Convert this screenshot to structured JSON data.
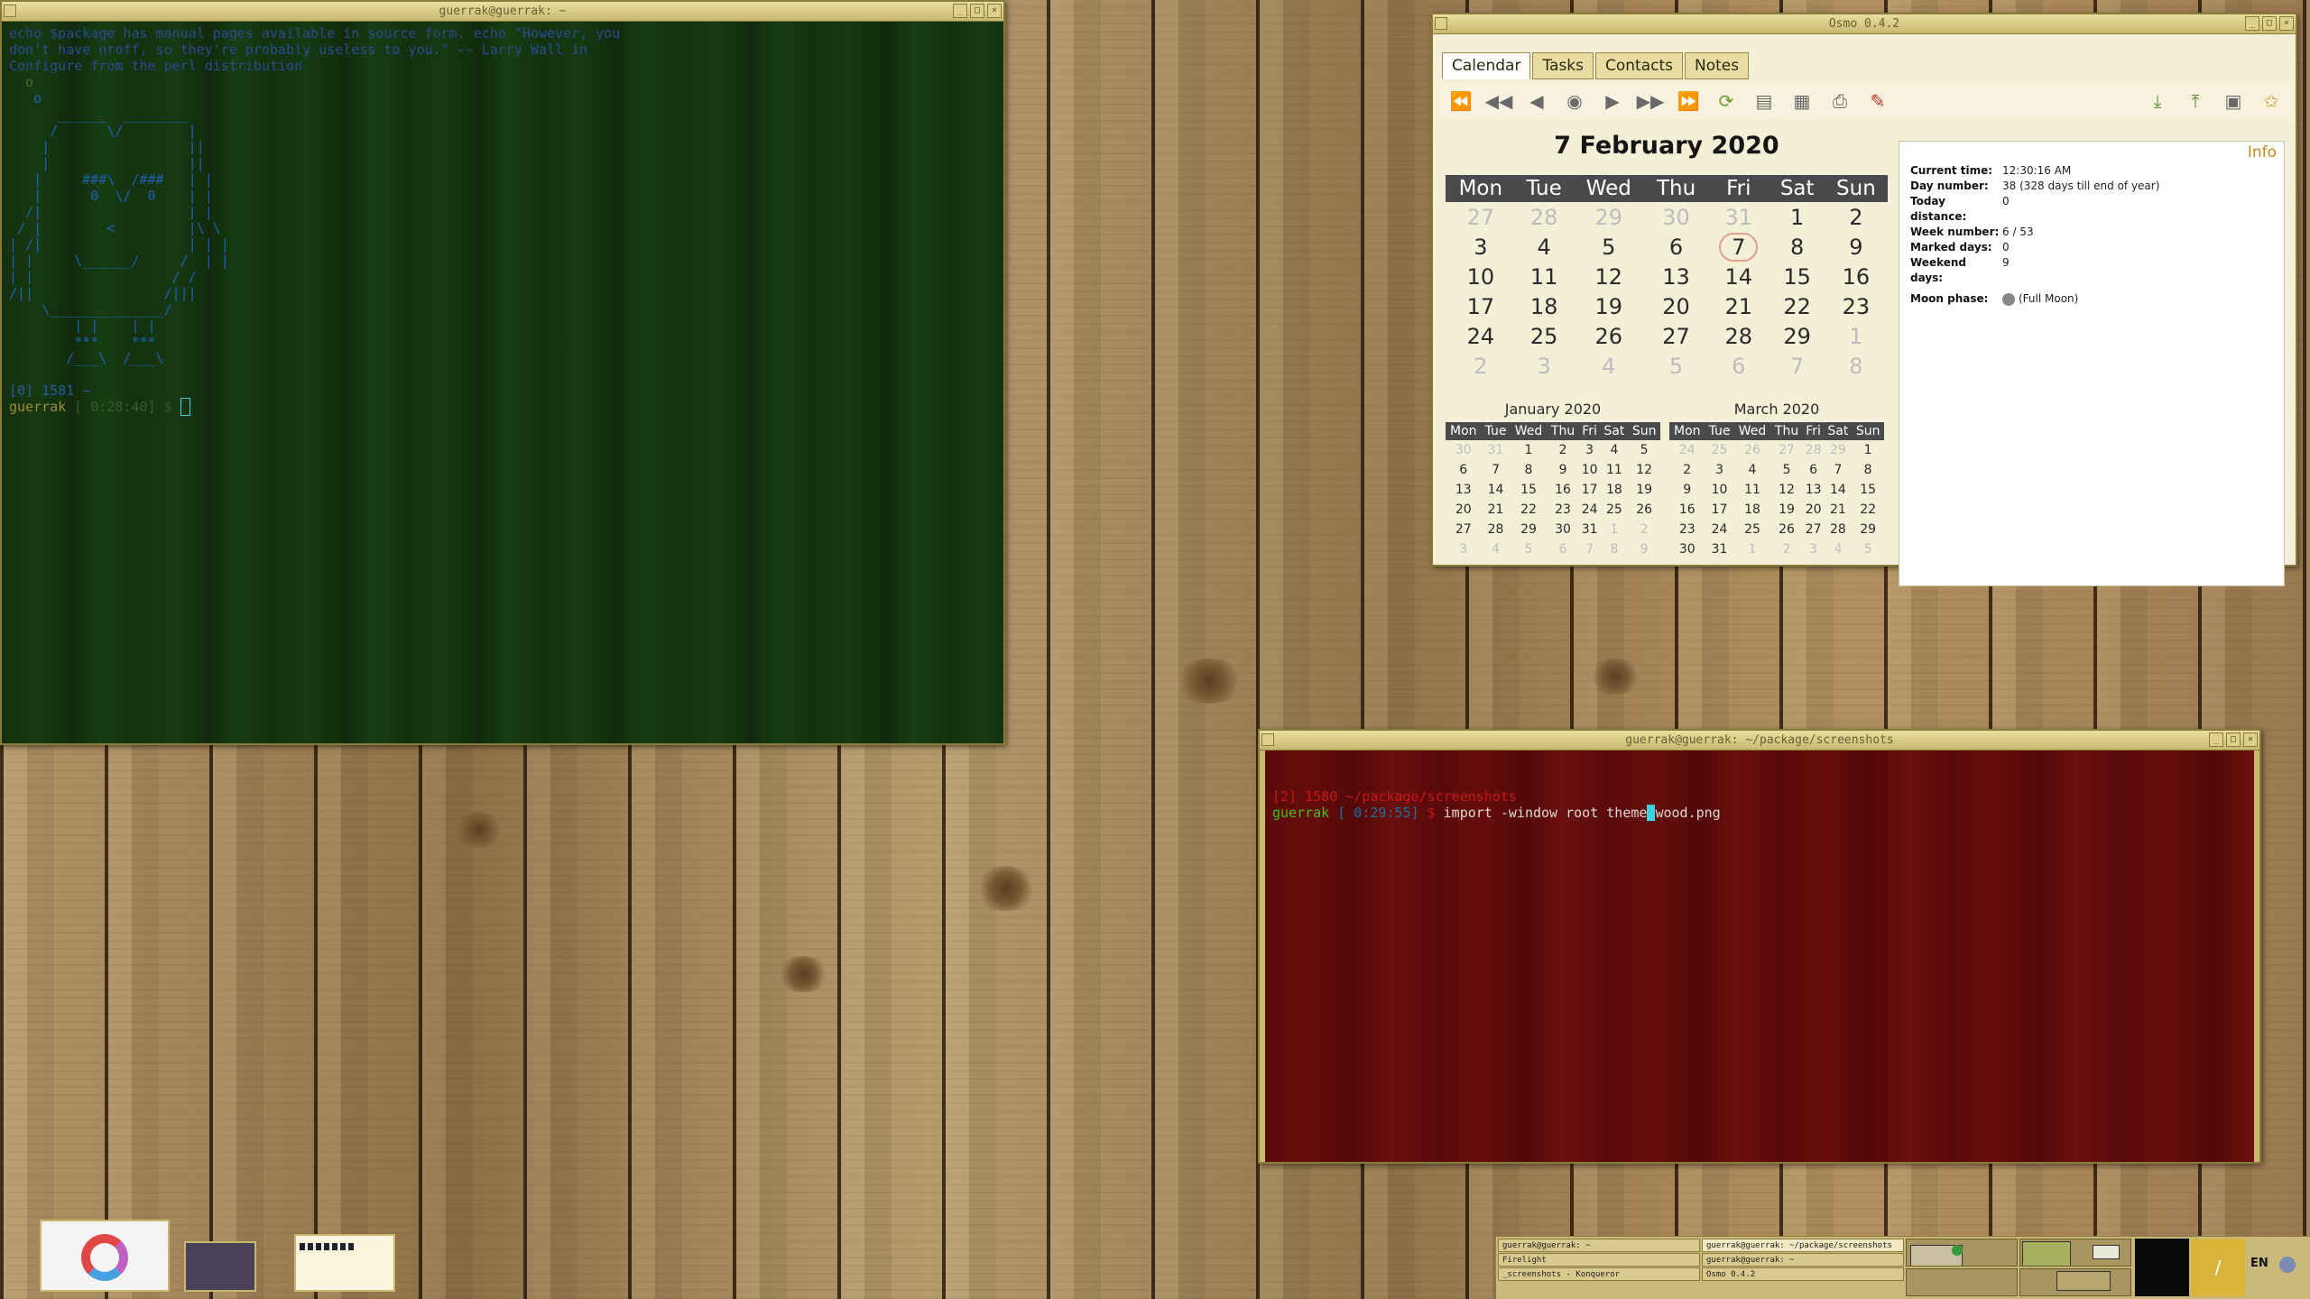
{
  "term1": {
    "title": "guerrak@guerrak: ~",
    "lines": [
      "echo $package has manual pages available in source form. echo \"However, you",
      "don't have nroff, so they're probably useless to you.\" -- Larry Wall in",
      "Configure from the perl distribution",
      "  o",
      "   o",
      "      ______  ________",
      "     /      \\/        |",
      "    |                 ||",
      "    |                 ||",
      "   |     ###\\  /###   | |",
      "   |      0  \\/  0    | |",
      "  /|                  | |",
      " / |        <         |\\ \\",
      "| /|                  | | |",
      "| |     \\______/     /  | |",
      "| |                 / /",
      "/||                /|||",
      "    \\______________/",
      "        | |    | |",
      "        ***    ***",
      "       /___\\  /___\\",
      "",
      "[0] 1581 ~",
      "guerrak [ 0:28:40] $ "
    ]
  },
  "term2": {
    "title": "guerrak@guerrak: ~/package/screenshots",
    "line1": "[2] 1580 ~/package/screenshots",
    "prompt_user": "guerrak",
    "prompt_time": "[ 0:29:55]",
    "prompt_sign": "$",
    "command_before": "import -window root theme",
    "command_cursor": "_",
    "command_after": "wood.png"
  },
  "calwin": {
    "title": "Osmo 0.4.2",
    "tabs": [
      "Calendar",
      "Tasks",
      "Contacts",
      "Notes"
    ],
    "month_title": "7 February 2020",
    "weekdays": [
      "Mon",
      "Tue",
      "Wed",
      "Thu",
      "Fri",
      "Sat",
      "Sun"
    ],
    "weeks": [
      [
        "27",
        "28",
        "29",
        "30",
        "31",
        "1",
        "2"
      ],
      [
        "3",
        "4",
        "5",
        "6",
        "7",
        "8",
        "9"
      ],
      [
        "10",
        "11",
        "12",
        "13",
        "14",
        "15",
        "16"
      ],
      [
        "17",
        "18",
        "19",
        "20",
        "21",
        "22",
        "23"
      ],
      [
        "24",
        "25",
        "26",
        "27",
        "28",
        "29",
        "1"
      ],
      [
        "2",
        "3",
        "4",
        "5",
        "6",
        "7",
        "8"
      ]
    ],
    "prev_month": {
      "title": "January 2020",
      "weeks": [
        [
          "30",
          "31",
          "1",
          "2",
          "3",
          "4",
          "5"
        ],
        [
          "6",
          "7",
          "8",
          "9",
          "10",
          "11",
          "12"
        ],
        [
          "13",
          "14",
          "15",
          "16",
          "17",
          "18",
          "19"
        ],
        [
          "20",
          "21",
          "22",
          "23",
          "24",
          "25",
          "26"
        ],
        [
          "27",
          "28",
          "29",
          "30",
          "31",
          "1",
          "2"
        ],
        [
          "3",
          "4",
          "5",
          "6",
          "7",
          "8",
          "9"
        ]
      ]
    },
    "next_month": {
      "title": "March 2020",
      "weeks": [
        [
          "24",
          "25",
          "26",
          "27",
          "28",
          "29",
          "1"
        ],
        [
          "2",
          "3",
          "4",
          "5",
          "6",
          "7",
          "8"
        ],
        [
          "9",
          "10",
          "11",
          "12",
          "13",
          "14",
          "15"
        ],
        [
          "16",
          "17",
          "18",
          "19",
          "20",
          "21",
          "22"
        ],
        [
          "23",
          "24",
          "25",
          "26",
          "27",
          "28",
          "29"
        ],
        [
          "30",
          "31",
          "1",
          "2",
          "3",
          "4",
          "5"
        ]
      ]
    },
    "info": {
      "header": "Info",
      "rows": [
        {
          "k": "Current time:",
          "v": "12:30:16 AM"
        },
        {
          "k": "Day number:",
          "v": "38 (328 days till end of year)"
        },
        {
          "k": "Today distance:",
          "v": "0"
        },
        {
          "k": "Week number:",
          "v": "6 / 53"
        },
        {
          "k": "Marked days:",
          "v": "0"
        },
        {
          "k": "Weekend days:",
          "v": "9"
        },
        {
          "k": "Moon phase:",
          "v": "(Full Moon)"
        }
      ]
    }
  },
  "taskbar": {
    "tasks": [
      "guerrak@guerrak: ~",
      "guerrak@guerrak: ~/package/screenshots",
      "Firelight",
      "guerrak@guerrak: ~",
      "_screenshots - Konqueror",
      "Osmo 0.4.2"
    ],
    "lang": "EN",
    "clock_glyph": "/"
  },
  "colors": {
    "prompt_user": "#48c020",
    "prompt_time": "#1a70a0",
    "prompt_sign": "#c01818",
    "dir": "#c81818",
    "weekend": "#9a1010",
    "green_text": "#4a6a30",
    "ascii_blue": "#2060b0"
  }
}
